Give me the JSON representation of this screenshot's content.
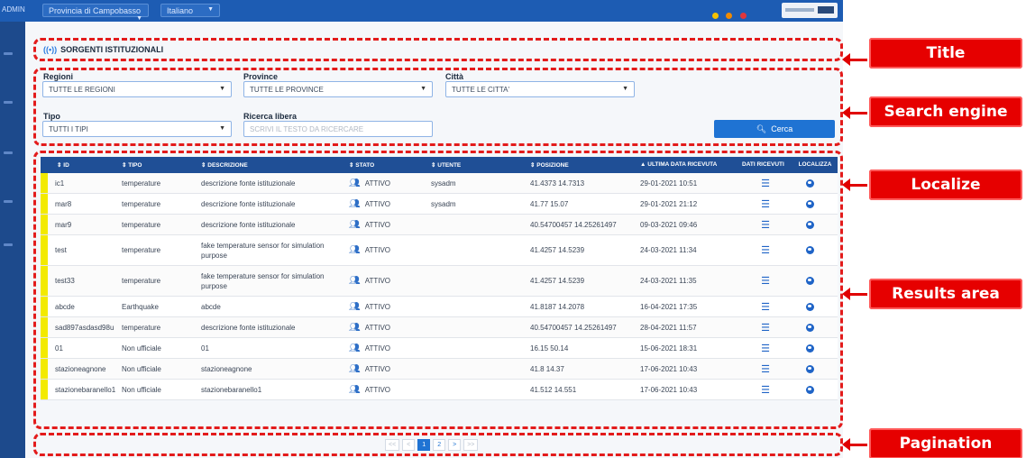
{
  "topbar": {
    "brand": "ADMIN",
    "province_select": "Provincia di Campobasso",
    "language_select": "Italiano",
    "dot_colors": [
      "#f5c200",
      "#f08a00",
      "#e0363b"
    ]
  },
  "title": "SORGENTI ISTITUZIONALI",
  "search": {
    "regioni_label": "Regioni",
    "regioni_value": "TUTTE LE REGIONI",
    "province_label": "Province",
    "province_value": "TUTTE LE PROVINCE",
    "citta_label": "Città",
    "citta_value": "TUTTE LE CITTA'",
    "tipo_label": "Tipo",
    "tipo_value": "TUTTI I TIPI",
    "ricerca_label": "Ricerca libera",
    "ricerca_placeholder": "SCRIVI IL TESTO DA RICERCARE",
    "search_button": "Cerca"
  },
  "table": {
    "headers": {
      "id": "ID",
      "tipo": "TIPO",
      "descrizione": "DESCRIZIONE",
      "stato": "STATO",
      "utente": "UTENTE",
      "posizione": "POSIZIONE",
      "data": "ULTIMA DATA RICEVUTA",
      "dati": "DATI RICEVUTI",
      "localizza": "LOCALIZZA"
    },
    "rows": [
      {
        "id": "ic1",
        "tipo": "temperature",
        "descrizione": "descrizione fonte istituzionale",
        "stato": "ATTIVO",
        "utente": "sysadm",
        "posizione": "41.4373 14.7313",
        "data": "29-01-2021 10:51",
        "tall": false
      },
      {
        "id": "mar8",
        "tipo": "temperature",
        "descrizione": "descrizione fonte istituzionale",
        "stato": "ATTIVO",
        "utente": "sysadm",
        "posizione": "41.77 15.07",
        "data": "29-01-2021 21:12",
        "tall": false
      },
      {
        "id": "mar9",
        "tipo": "temperature",
        "descrizione": "descrizione fonte istituzionale",
        "stato": "ATTIVO",
        "utente": "",
        "posizione": "40.54700457 14.25261497",
        "data": "09-03-2021 09:46",
        "tall": false
      },
      {
        "id": "test",
        "tipo": "temperature",
        "descrizione": "fake temperature sensor for simulation purpose",
        "stato": "ATTIVO",
        "utente": "",
        "posizione": "41.4257 14.5239",
        "data": "24-03-2021 11:34",
        "tall": true
      },
      {
        "id": "test33",
        "tipo": "temperature",
        "descrizione": "fake temperature sensor for simulation purpose",
        "stato": "ATTIVO",
        "utente": "",
        "posizione": "41.4257 14.5239",
        "data": "24-03-2021 11:35",
        "tall": true
      },
      {
        "id": "abcde",
        "tipo": "Earthquake",
        "descrizione": "abcde",
        "stato": "ATTIVO",
        "utente": "",
        "posizione": "41.8187 14.2078",
        "data": "16-04-2021 17:35",
        "tall": false
      },
      {
        "id": "sad897asdasd98u",
        "tipo": "temperature",
        "descrizione": "descrizione fonte istituzionale",
        "stato": "ATTIVO",
        "utente": "",
        "posizione": "40.54700457 14.25261497",
        "data": "28-04-2021 11:57",
        "tall": false
      },
      {
        "id": "01",
        "tipo": "Non ufficiale",
        "descrizione": "01",
        "stato": "ATTIVO",
        "utente": "",
        "posizione": "16.15 50.14",
        "data": "15-06-2021 18:31",
        "tall": false
      },
      {
        "id": "stazioneagnone",
        "tipo": "Non ufficiale",
        "descrizione": "stazioneagnone",
        "stato": "ATTIVO",
        "utente": "",
        "posizione": "41.8 14.37",
        "data": "17-06-2021 10:43",
        "tall": false
      },
      {
        "id": "stazionebaranello1",
        "tipo": "Non ufficiale",
        "descrizione": "stazionebaranello1",
        "stato": "ATTIVO",
        "utente": "",
        "posizione": "41.512 14.551",
        "data": "17-06-2021 10:43",
        "tall": false
      }
    ]
  },
  "pagination": {
    "first": "<<",
    "prev": "<",
    "pages": [
      "1",
      "2"
    ],
    "active_page": "1",
    "next": ">",
    "last": ">>"
  },
  "callouts": {
    "title": "Title",
    "search_engine": "Search engine",
    "localize": "Localize",
    "results_area": "Results area",
    "pagination": "Pagination"
  }
}
